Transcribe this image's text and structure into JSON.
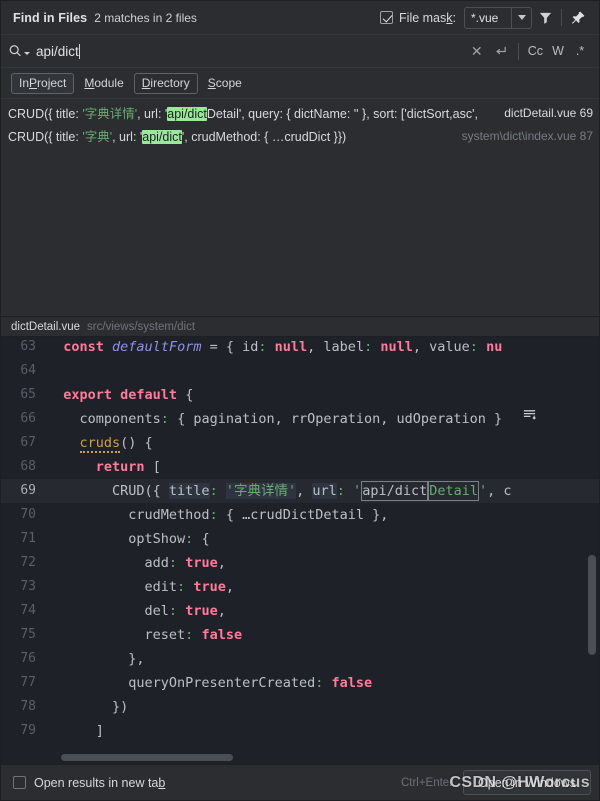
{
  "header": {
    "title": "Find in Files",
    "summary": "2 matches in 2 files",
    "mask_checked": true,
    "mask_label": "File mask:",
    "mask_value": "*.vue",
    "filter_icon": "filter-icon",
    "pin_icon": "pin-icon"
  },
  "search": {
    "icon": "search-icon",
    "query": "api/dict",
    "clear_icon": "close-icon",
    "newline_icon": "new-line-icon",
    "toggle_case": "Cc",
    "toggle_words": "W",
    "toggle_regex": ".*"
  },
  "scope": {
    "tabs": [
      {
        "label": "In Project",
        "selected": true
      },
      {
        "label": "Module",
        "selected": false
      },
      {
        "label": "Directory",
        "selected": false
      },
      {
        "label": "Scope",
        "selected": false
      }
    ]
  },
  "results": [
    {
      "pre": "CRUD({ title: ",
      "title": "'字典详情'",
      "mid": ", url: '",
      "match": "api/dict",
      "post": "Detail', query: { dictName: '' }, sort: ['dictSort,asc',",
      "file": "dictDetail.vue",
      "line": "69",
      "selected": false
    },
    {
      "pre": "CRUD({ title: ",
      "title": "'字典'",
      "mid": ", url: '",
      "match": "api/dict",
      "post": "', crudMethod: { …crudDict }})",
      "file": "system\\dict\\index.vue",
      "line": "87",
      "selected": false
    }
  ],
  "preview": {
    "file_name": "dictDetail.vue",
    "file_path": "src/views/system/dict",
    "fold_icon": "collapse-all-icon",
    "lines": [
      {
        "n": "63",
        "text": "  const defaultForm = { id: null, label: null, value: nu"
      },
      {
        "n": "64",
        "text": ""
      },
      {
        "n": "65",
        "text": "  export default {"
      },
      {
        "n": "66",
        "text": "    components: { pagination, rrOperation, udOperation }"
      },
      {
        "n": "67",
        "text": "    cruds() {"
      },
      {
        "n": "68",
        "text": "      return ["
      },
      {
        "n": "69",
        "text": "        CRUD({ title: '字典详情', url: 'api/dictDetail', c"
      },
      {
        "n": "70",
        "text": "          crudMethod: { …crudDictDetail },"
      },
      {
        "n": "71",
        "text": "          optShow: {"
      },
      {
        "n": "72",
        "text": "            add: true,"
      },
      {
        "n": "73",
        "text": "            edit: true,"
      },
      {
        "n": "74",
        "text": "            del: true,"
      },
      {
        "n": "75",
        "text": "            reset: false"
      },
      {
        "n": "76",
        "text": "          },"
      },
      {
        "n": "77",
        "text": "          queryOnPresenterCreated: false"
      },
      {
        "n": "78",
        "text": "        })"
      },
      {
        "n": "79",
        "text": "      ]"
      }
    ],
    "current_line": "69"
  },
  "footer": {
    "checkbox_checked": false,
    "open_new_tab_label": "Open results in new tab",
    "shortcut": "Ctrl+Enter",
    "open_button": "Open in Windows"
  },
  "watermark": "CSDN @HWorcus",
  "colors": {
    "background": "#2b2d30",
    "editor_background": "#1e2127",
    "match_highlight": "#9ae89b",
    "string_green": "#6aab73",
    "keyword_pink": "#ff7b9c"
  }
}
